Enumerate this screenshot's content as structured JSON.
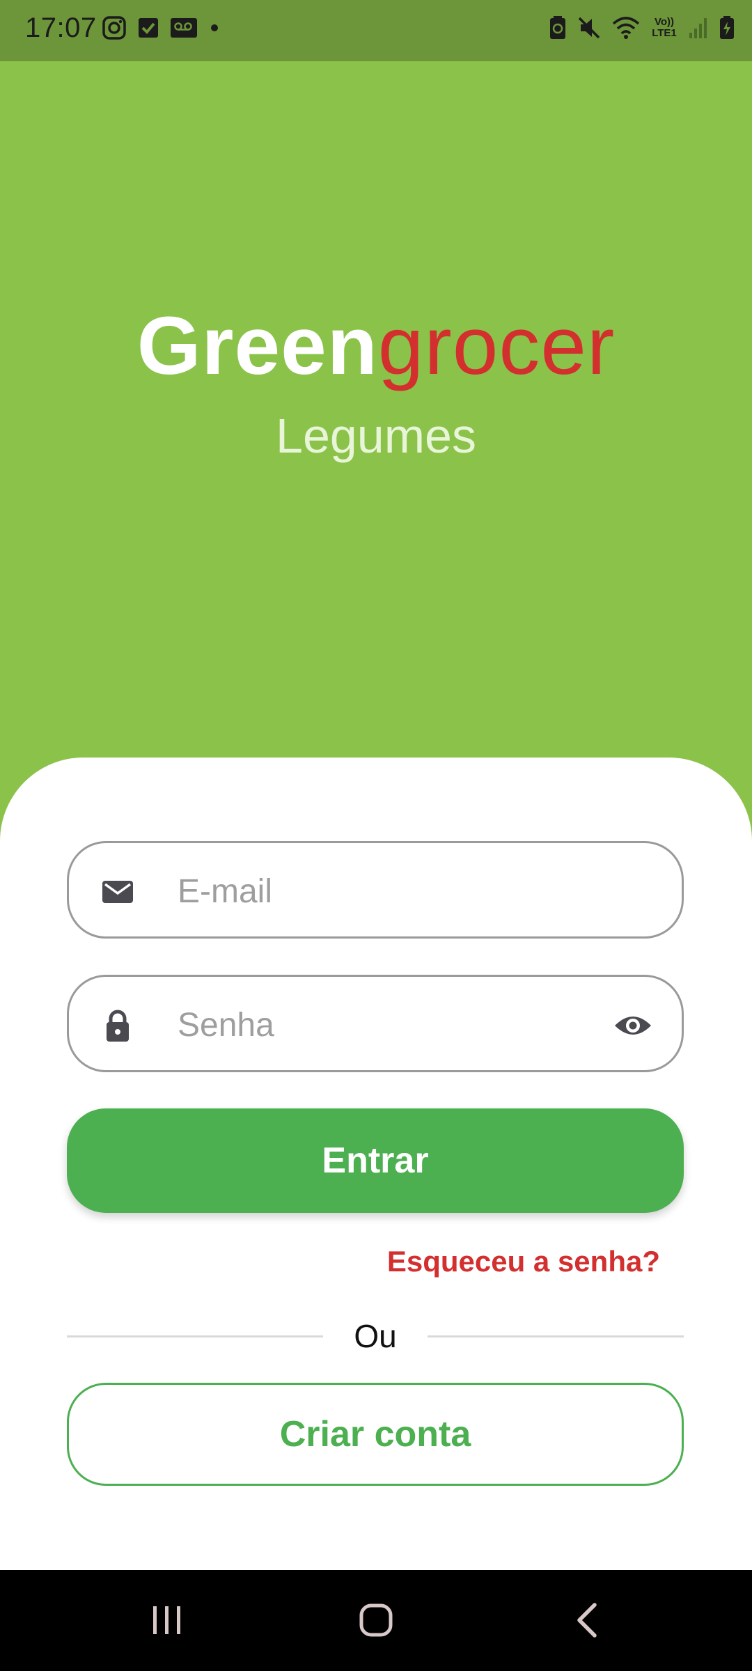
{
  "status_bar": {
    "time": "17:07",
    "left_icons": [
      "instagram-icon",
      "checkbox-icon",
      "voicemail-icon",
      "dot-icon"
    ],
    "right_icons": [
      "battery-saver-icon",
      "mute-icon",
      "wifi-icon",
      "volte-icon",
      "signal-icon",
      "battery-icon"
    ],
    "volte_label": "Vo)) LTE1"
  },
  "brand": {
    "part1": "Green",
    "part2": "grocer",
    "subtitle": "Legumes"
  },
  "form": {
    "email_placeholder": "E-mail",
    "password_placeholder": "Senha",
    "login_label": "Entrar",
    "forgot_label": "Esqueceu a senha?",
    "or_label": "Ou",
    "create_account_label": "Criar conta"
  },
  "colors": {
    "hero_bg": "#8bc34a",
    "primary_green": "#4caf50",
    "accent_red": "#d32f2f"
  },
  "nav_bar": {
    "buttons": [
      "recents-icon",
      "home-icon",
      "back-icon"
    ]
  }
}
